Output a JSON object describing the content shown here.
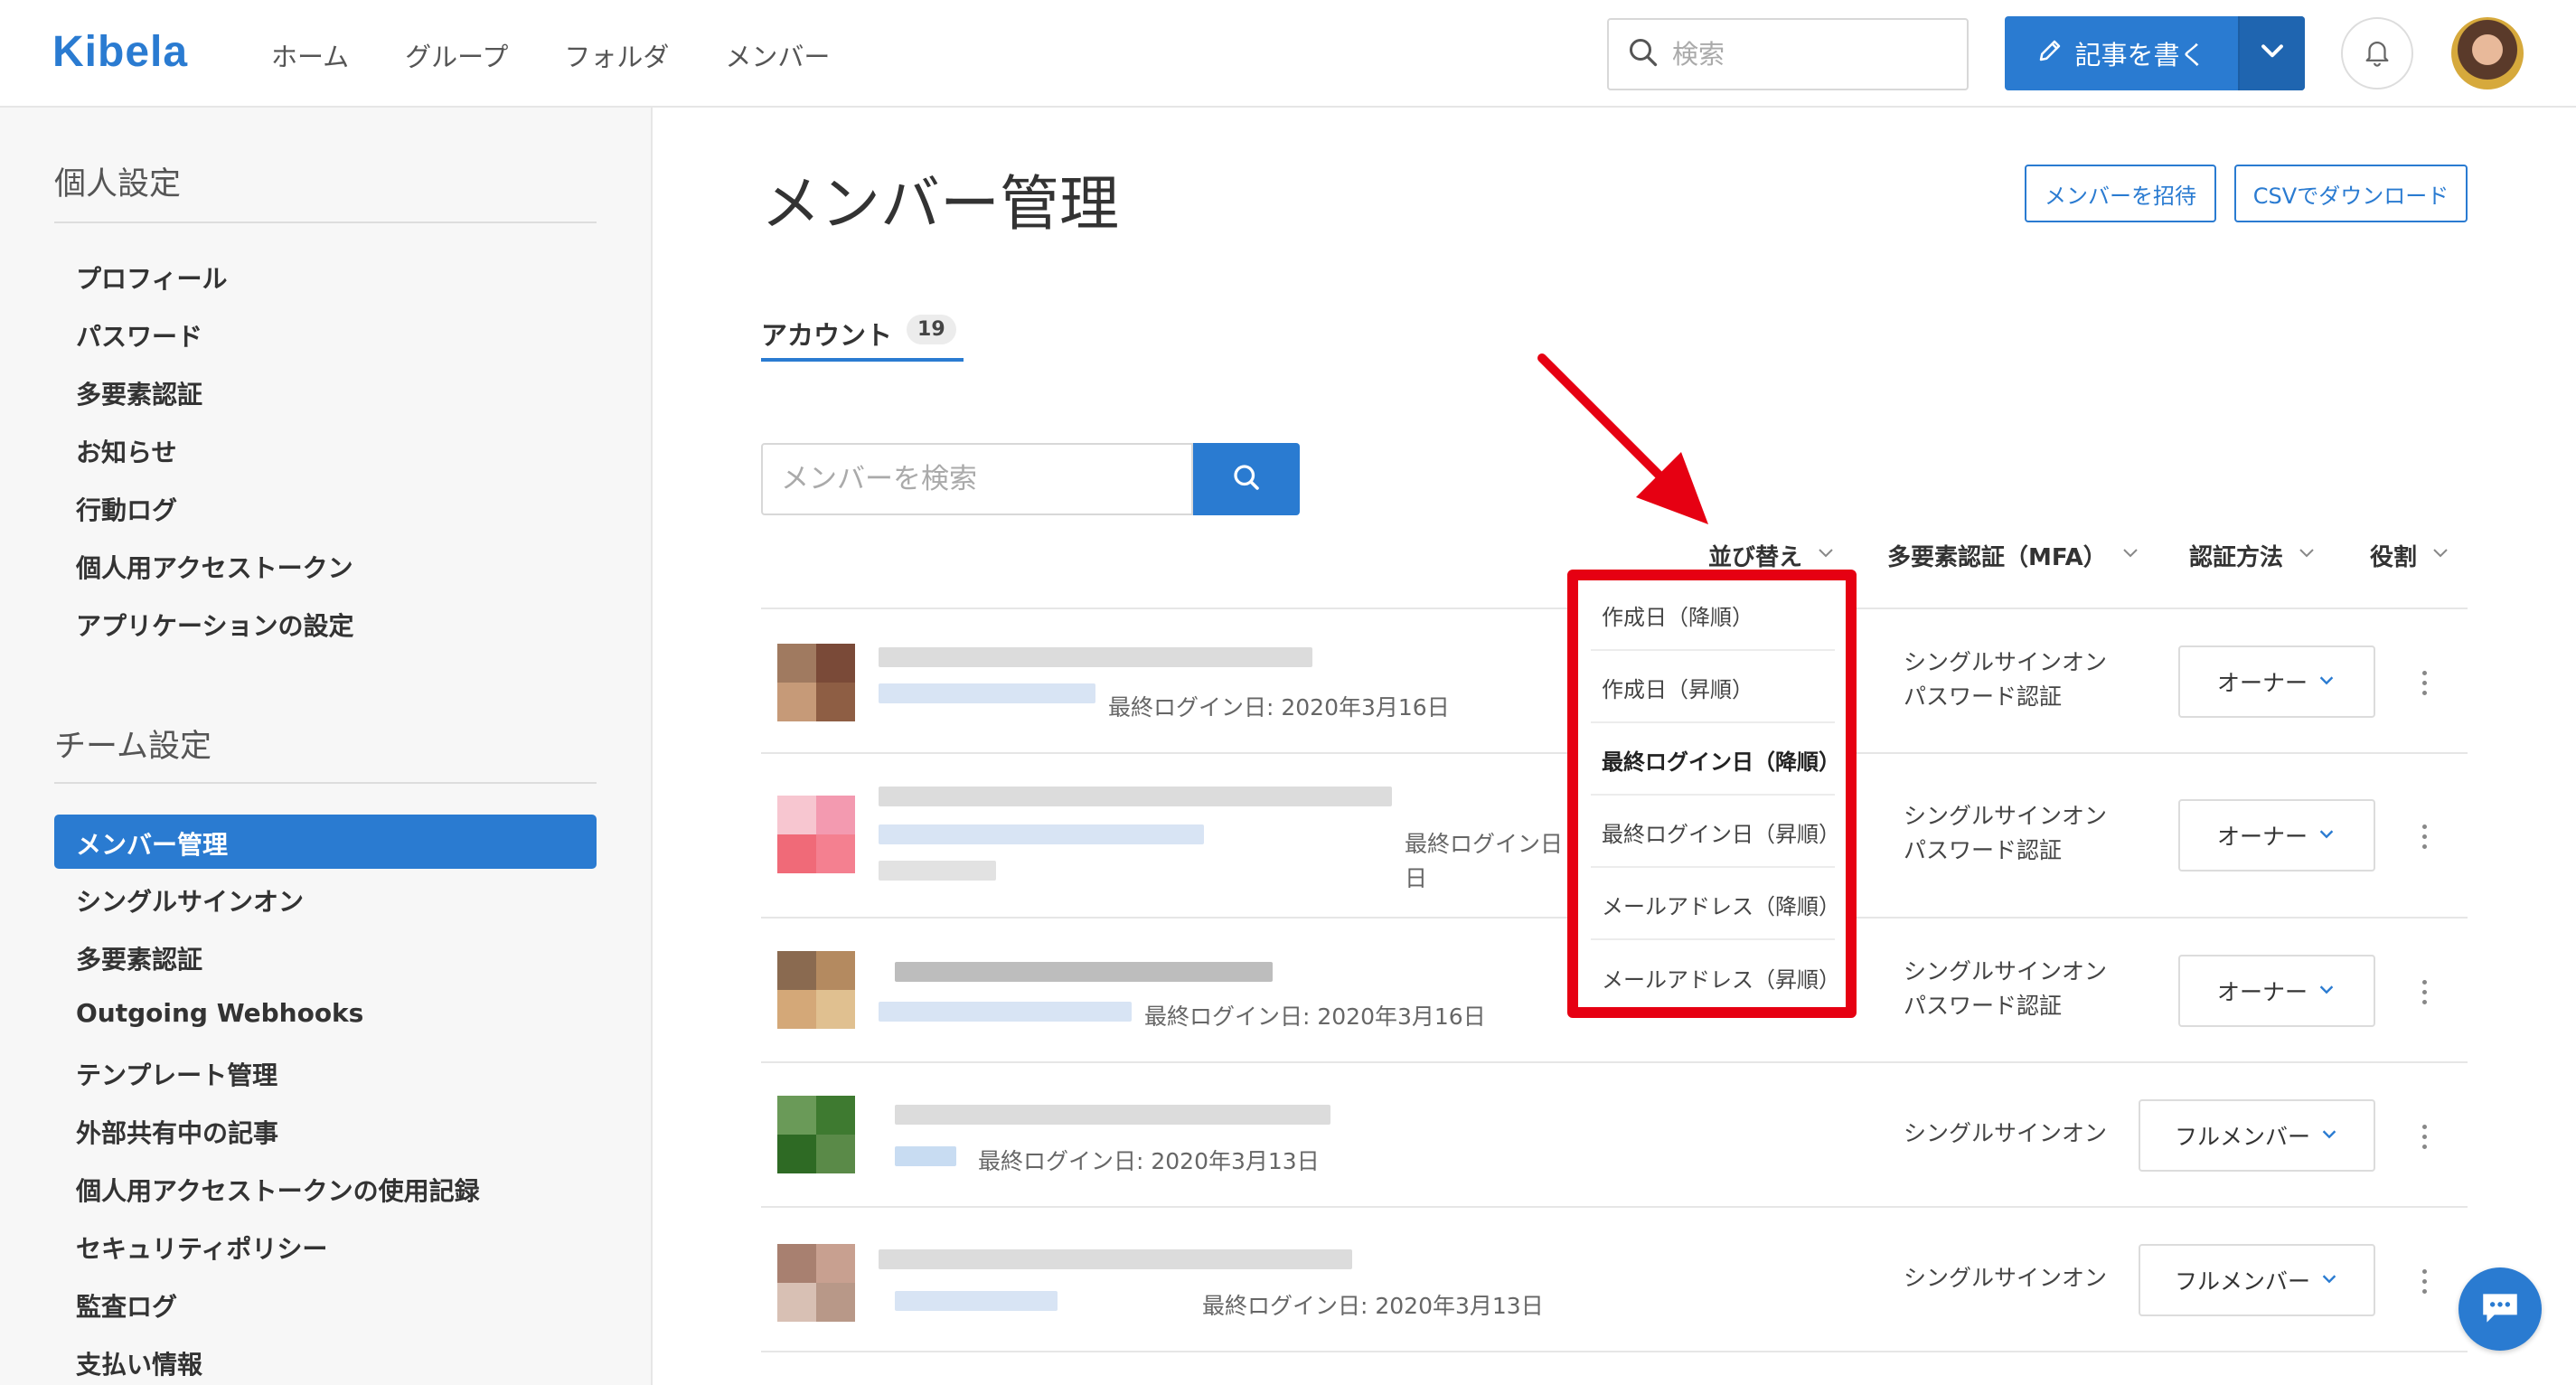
{
  "header": {
    "logo": "Kibela",
    "nav": [
      "ホーム",
      "グループ",
      "フォルダ",
      "メンバー"
    ],
    "search_placeholder": "検索",
    "write_button": "記事を書く"
  },
  "sidebar": {
    "personal_heading": "個人設定",
    "personal_items": [
      "プロフィール",
      "パスワード",
      "多要素認証",
      "お知らせ",
      "行動ログ",
      "個人用アクセストークン",
      "アプリケーションの設定"
    ],
    "team_heading": "チーム設定",
    "team_active": "メンバー管理",
    "team_items": [
      "シングルサインオン",
      "多要素認証",
      "Outgoing Webhooks",
      "テンプレート管理",
      "外部共有中の記事",
      "個人用アクセストークンの使用記録",
      "セキュリティポリシー",
      "監査ログ",
      "支払い情報"
    ]
  },
  "main": {
    "title": "メンバー管理",
    "invite_button": "メンバーを招待",
    "csv_button": "CSVでダウンロード",
    "tab_label": "アカウント",
    "tab_count": "19",
    "member_search_placeholder": "メンバーを検索",
    "filters": {
      "sort": "並び替え",
      "mfa": "多要素認証（MFA）",
      "auth": "認証方法",
      "role": "役割"
    },
    "rows": [
      {
        "login": "最終ログイン日: 2020年3月16日",
        "auth1": "シングルサインオン",
        "auth2": "パスワード認証",
        "role": "オーナー"
      },
      {
        "login_l1": "最終ログイン日",
        "login_l2": "日",
        "auth1": "シングルサインオン",
        "auth2": "パスワード認証",
        "role": "オーナー"
      },
      {
        "login": "最終ログイン日: 2020年3月16日",
        "auth1": "シングルサインオン",
        "auth2": "パスワード認証",
        "role": "オーナー"
      },
      {
        "login": "最終ログイン日: 2020年3月13日",
        "auth1": "シングルサインオン",
        "role": "フルメンバー"
      },
      {
        "login": "最終ログイン日: 2020年3月13日",
        "auth1": "シングルサインオン",
        "role": "フルメンバー"
      }
    ]
  },
  "sort_dropdown": [
    "作成日（降順）",
    "作成日（昇順）",
    "最終ログイン日（降順）",
    "最終ログイン日（昇順）",
    "メールアドレス（降順）",
    "メールアドレス（昇順）"
  ],
  "colors": {
    "accent": "#2a7bd1",
    "highlight": "#e60012"
  }
}
